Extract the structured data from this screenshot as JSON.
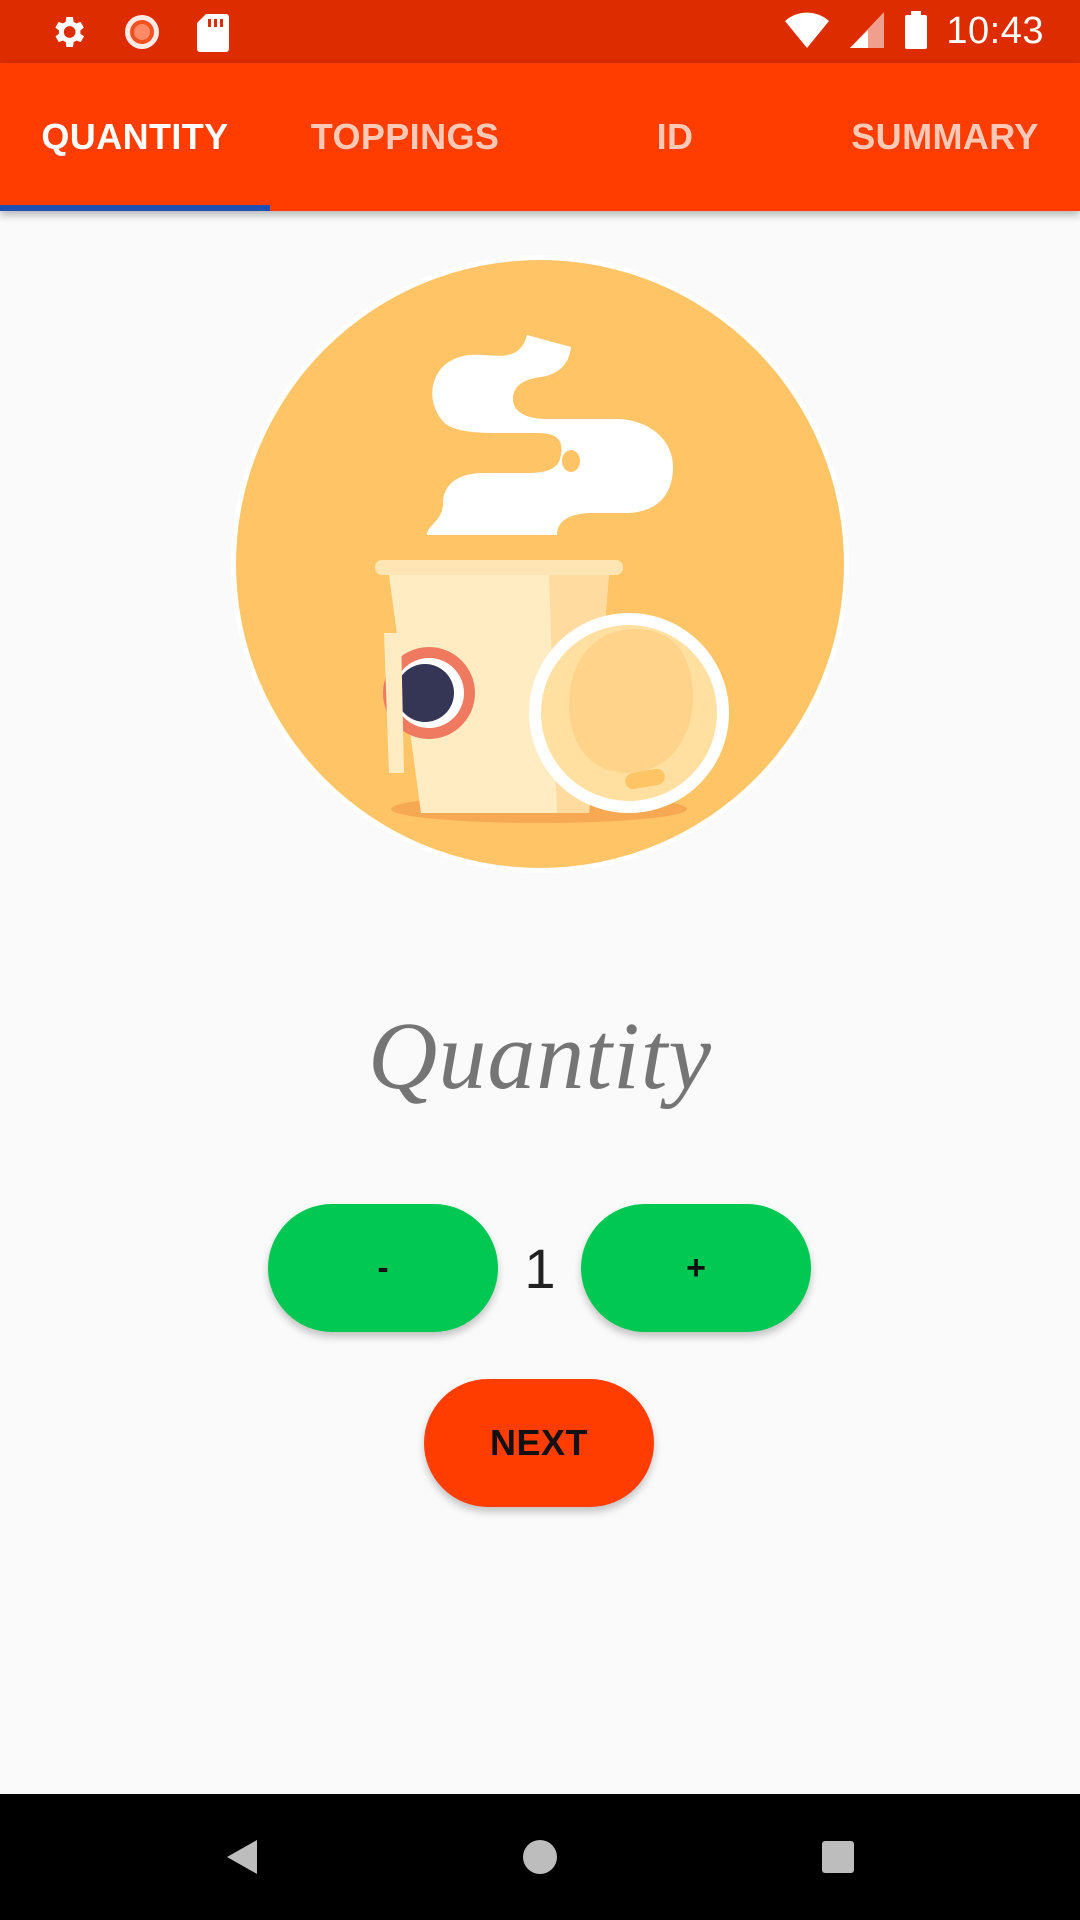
{
  "status_bar": {
    "time": "10:43",
    "left_icons": [
      "gear-icon",
      "sync-icon",
      "sd-card-icon"
    ],
    "right_icons": [
      "wifi-icon",
      "signal-icon",
      "battery-icon"
    ],
    "color": "#dd2c00"
  },
  "tabs": [
    {
      "label": "QUANTITY",
      "active": true
    },
    {
      "label": "TOPPINGS",
      "active": false
    },
    {
      "label": "ID",
      "active": false
    },
    {
      "label": "SUMMARY",
      "active": false
    }
  ],
  "tab_bar_color": "#ff3d00",
  "tab_indicator_color": "#1e4fb3",
  "main": {
    "illustration": "coffee-cup-icon",
    "heading": "Quantity",
    "quantity": {
      "minus_label": "-",
      "value": "1",
      "plus_label": "+"
    },
    "next_label": "NEXT"
  },
  "colors": {
    "stepper_buttons": "#00c853",
    "next_button": "#ff3d00"
  },
  "nav_bar": {
    "buttons": [
      "back-icon",
      "home-icon",
      "recents-icon"
    ]
  }
}
